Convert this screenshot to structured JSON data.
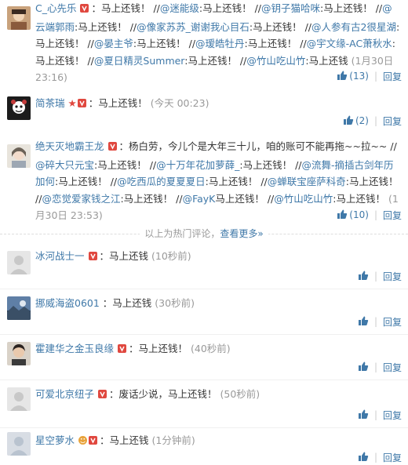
{
  "hot_comments": [
    {
      "user": "C_心先乐",
      "intro": "：马上还钱！ //",
      "mentions": [
        {
          "name": "@迷能级",
          "text": ":马上还钱！ //"
        },
        {
          "name": "@钥子猫哈咪",
          "text": ":马上还钱！ //"
        },
        {
          "name": "@云端郭雨",
          "text": ":马上还钱！ //"
        },
        {
          "name": "@像家苏苏_谢谢我心目石",
          "text": ":马上还钱！ //"
        },
        {
          "name": "@人参有古2很星湖",
          "text": ":马上还钱！ //"
        },
        {
          "name": "@晏主爷",
          "text": ":马上还钱！ //"
        },
        {
          "name": "@瑷皓牡丹",
          "text": ":马上还钱！ //"
        },
        {
          "name": "@宇文缘-AC萧秋水",
          "text": ":马上还钱！ //"
        },
        {
          "name": "@夏日精灵Summer",
          "text": ":马上还钱！ //"
        },
        {
          "name": "@竹山吃山竹",
          "text": ":马上还钱"
        }
      ],
      "time": "(1月30日 23:16)",
      "likes": "(13)",
      "reply": "回复"
    },
    {
      "user": "简茶瑞",
      "text": "：马上还钱！",
      "time": "(今天 00:23)",
      "likes": "(2)",
      "reply": "回复"
    },
    {
      "user": "绝天灭地霸王龙",
      "intro": "：杨白劳，今儿个是大年三十儿，咱的账可不能再拖~~拉~~ //",
      "mentions": [
        {
          "name": "@碎大只元宝",
          "text": ":马上还钱！ //"
        },
        {
          "name": "@十万年花加萝薛_",
          "text": ":马上还钱！ //"
        },
        {
          "name": "@流舞-摘插古剑年历加何",
          "text": ":马上还钱！ //"
        },
        {
          "name": "@吃西瓜的夏夏夏日",
          "text": ":马上还钱！ //"
        },
        {
          "name": "@蝉联宝座萨科奇",
          "text": ":马上还钱！ //"
        },
        {
          "name": "@恋觉爱家钱之江",
          "text": ":马上还钱！ //"
        },
        {
          "name": "@FayK",
          "text": "马上还钱！ //"
        },
        {
          "name": "@竹山吃山竹",
          "text": ":马上还钱！"
        }
      ],
      "time": "(1月30日 23:53)",
      "likes": "(10)",
      "reply": "回复"
    }
  ],
  "hot_note": {
    "text": "以上为热门评论，",
    "more": "查看更多»"
  },
  "recent_comments": [
    {
      "user": "冰河战士一",
      "text": "：马上还钱",
      "time": "(10秒前)",
      "reply": "回复"
    },
    {
      "user": "挪威海盗0601",
      "text": "：马上还钱",
      "time": "(30秒前)",
      "reply": "回复"
    },
    {
      "user": "霍建华之金玉良缘",
      "text": "：马上还钱！",
      "time": "(40秒前)",
      "reply": "回复"
    },
    {
      "user": "可爱北京纽子",
      "text": "：废话少说，马上还钱！",
      "time": "(50秒前)",
      "reply": "回复"
    },
    {
      "user": "星空萝水",
      "text": "：马上还钱",
      "time": "(1分钟前)",
      "reply": "回复"
    }
  ],
  "colors": {
    "link": "#3f78a8",
    "muted": "#999999",
    "vip_badge": "#e0483f"
  }
}
